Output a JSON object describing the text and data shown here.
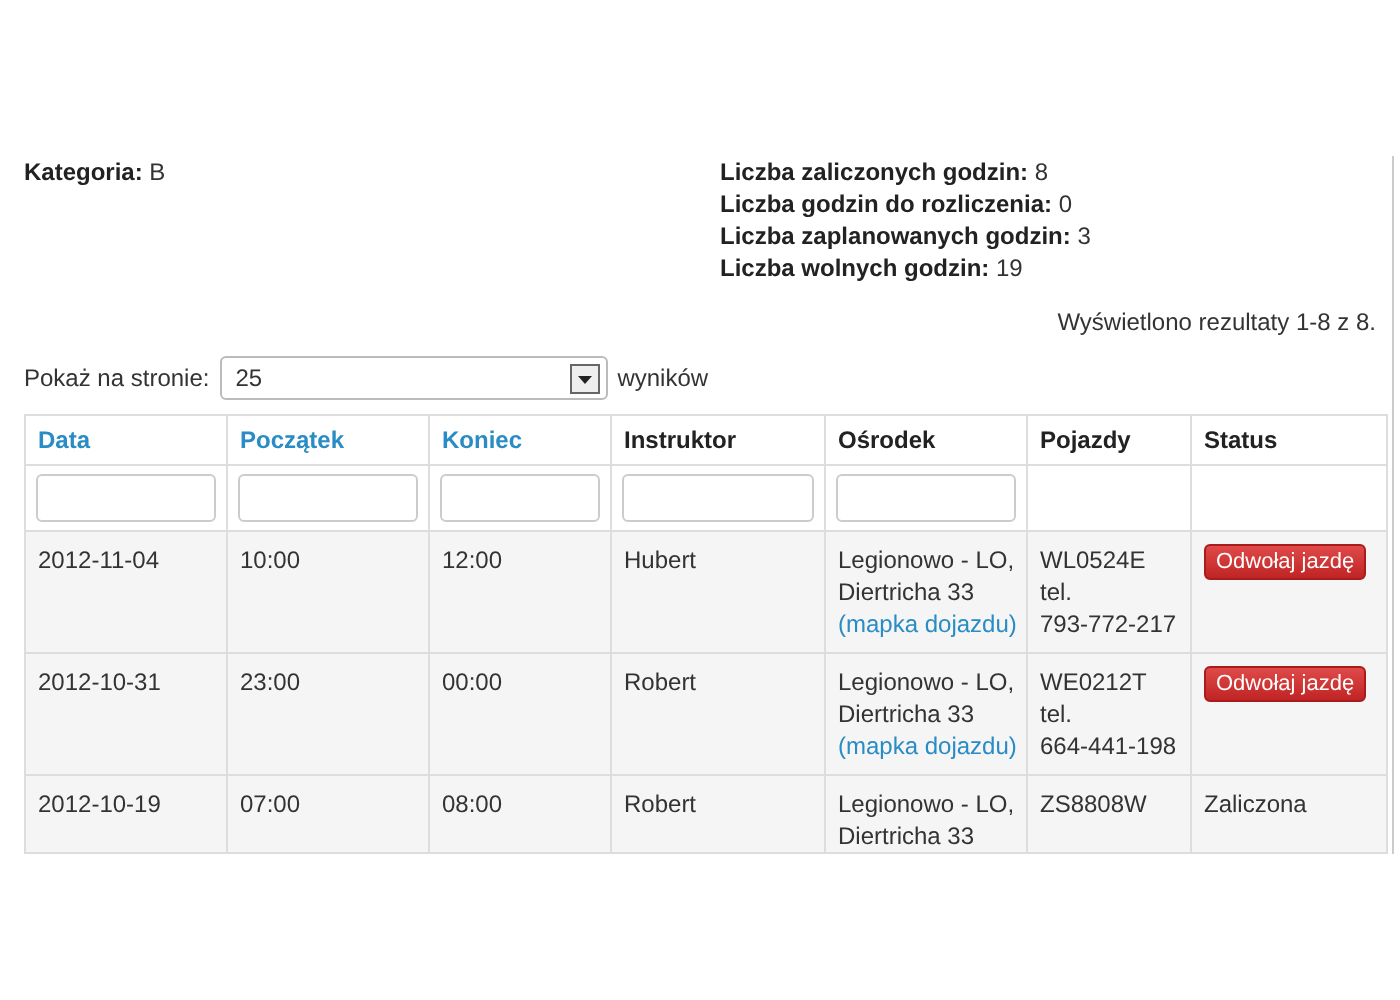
{
  "summary": {
    "left": [
      "**Kategoria:** B"
    ],
    "right": [
      "**Liczba zaliczonych godzin:** 8",
      "**Liczba godzin do rozliczenia:** 0",
      "**Liczba zaplanowanych godzin:** 3",
      "**Liczba wolnych godzin:** 19"
    ]
  },
  "results_info": "Wyświetlono rezultaty 1-8 z 8.",
  "page_size": {
    "label": "Pokaż na stronie:",
    "value": "25",
    "suffix": "wyników"
  },
  "table": {
    "columns": [
      {
        "label": "Data",
        "sortable": true,
        "filter": true
      },
      {
        "label": "Początek",
        "sortable": true,
        "filter": true
      },
      {
        "label": "Koniec",
        "sortable": true,
        "filter": true
      },
      {
        "label": "Instruktor",
        "sortable": false,
        "filter": true
      },
      {
        "label": "Ośrodek",
        "sortable": false,
        "filter": true
      },
      {
        "label": "Pojazdy",
        "sortable": false,
        "filter": false
      },
      {
        "label": "Status",
        "sortable": false,
        "filter": false
      }
    ],
    "rows": [
      {
        "date": "2012-11-04",
        "start": "10:00",
        "end": "12:00",
        "instructor": "Hubert",
        "center": {
          "lines": [
            "Legionowo - LO,",
            "Diertricha 33"
          ],
          "link": "(mapka dojazdu)"
        },
        "vehicle": [
          "WL0524E",
          "tel.",
          "793-772-217"
        ],
        "status": {
          "kind": "button",
          "text": "Odwołaj jazdę"
        }
      },
      {
        "date": "2012-10-31",
        "start": "23:00",
        "end": "00:00",
        "instructor": "Robert",
        "center": {
          "lines": [
            "Legionowo - LO,",
            "Diertricha 33"
          ],
          "link": "(mapka dojazdu)"
        },
        "vehicle": [
          "WE0212T",
          "tel.",
          "664-441-198"
        ],
        "status": {
          "kind": "button",
          "text": "Odwołaj jazdę"
        }
      },
      {
        "date": "2012-10-19",
        "start": "07:00",
        "end": "08:00",
        "instructor": "Robert",
        "center": {
          "lines": [
            "Legionowo - LO,",
            "Diertricha 33"
          ]
        },
        "vehicle": [
          "ZS8808W"
        ],
        "status": {
          "kind": "text",
          "text": "Zaliczona"
        }
      }
    ]
  }
}
